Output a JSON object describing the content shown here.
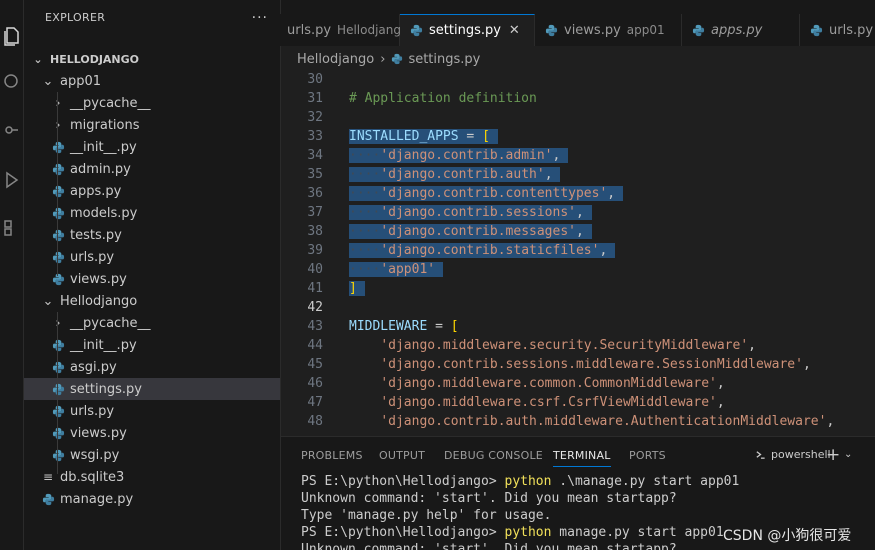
{
  "sidebar": {
    "title": "EXPLORER",
    "more": "···",
    "tree": [
      {
        "label": "HELLODJANGO",
        "kind": "root"
      },
      {
        "label": "app01",
        "kind": "folder-open"
      },
      {
        "label": "__pycache__",
        "kind": "folder"
      },
      {
        "label": "migrations",
        "kind": "folder"
      },
      {
        "label": "__init__.py",
        "kind": "py"
      },
      {
        "label": "admin.py",
        "kind": "py"
      },
      {
        "label": "apps.py",
        "kind": "py"
      },
      {
        "label": "models.py",
        "kind": "py"
      },
      {
        "label": "tests.py",
        "kind": "py"
      },
      {
        "label": "urls.py",
        "kind": "py"
      },
      {
        "label": "views.py",
        "kind": "py"
      },
      {
        "label": "Hellodjango",
        "kind": "folder-open"
      },
      {
        "label": "__pycache__",
        "kind": "folder"
      },
      {
        "label": "__init__.py",
        "kind": "py"
      },
      {
        "label": "asgi.py",
        "kind": "py"
      },
      {
        "label": "settings.py",
        "kind": "py",
        "selected": true
      },
      {
        "label": "urls.py",
        "kind": "py"
      },
      {
        "label": "views.py",
        "kind": "py"
      },
      {
        "label": "wsgi.py",
        "kind": "py"
      },
      {
        "label": "db.sqlite3",
        "kind": "db"
      },
      {
        "label": "manage.py",
        "kind": "py"
      }
    ]
  },
  "tabs": [
    {
      "label": "urls.py",
      "desc": "Hellodjango"
    },
    {
      "label": "settings.py",
      "desc": "",
      "active": true
    },
    {
      "label": "views.py",
      "desc": "app01"
    },
    {
      "label": "apps.py",
      "desc": "",
      "italic": true
    },
    {
      "label": "urls.py",
      "desc": ""
    }
  ],
  "breadcrumb": {
    "folder": "Hellodjango",
    "file": "settings.py"
  },
  "editor": {
    "current_line": "42",
    "lines": [
      {
        "n": "30",
        "text": ""
      },
      {
        "n": "31",
        "text": "# Application definition"
      },
      {
        "n": "32",
        "text": ""
      },
      {
        "n": "33",
        "text": "INSTALLED_APPS = ["
      },
      {
        "n": "34",
        "text": "'django.contrib.admin',"
      },
      {
        "n": "35",
        "text": "'django.contrib.auth',"
      },
      {
        "n": "36",
        "text": "'django.contrib.contenttypes',"
      },
      {
        "n": "37",
        "text": "'django.contrib.sessions',"
      },
      {
        "n": "38",
        "text": "'django.contrib.messages',"
      },
      {
        "n": "39",
        "text": "'django.contrib.staticfiles',"
      },
      {
        "n": "40",
        "text": "'app01'"
      },
      {
        "n": "41",
        "text": "]"
      },
      {
        "n": "42",
        "text": ""
      },
      {
        "n": "43",
        "text": "MIDDLEWARE = ["
      },
      {
        "n": "44",
        "text": "'django.middleware.security.SecurityMiddleware',"
      },
      {
        "n": "45",
        "text": "'django.contrib.sessions.middleware.SessionMiddleware',"
      },
      {
        "n": "46",
        "text": "'django.middleware.common.CommonMiddleware',"
      },
      {
        "n": "47",
        "text": "'django.middleware.csrf.CsrfViewMiddleware',"
      },
      {
        "n": "48",
        "text": "'django.contrib.auth.middleware.AuthenticationMiddleware',"
      }
    ]
  },
  "panel": {
    "tabs": [
      "PROBLEMS",
      "OUTPUT",
      "DEBUG CONSOLE",
      "TERMINAL",
      "PORTS"
    ],
    "active_tab": "TERMINAL",
    "shell": "powershell",
    "terminal": [
      {
        "prompt": "PS E:\\python\\Hellodjango> ",
        "cmd": "python",
        "rest": " .\\manage.py start app01"
      },
      {
        "prompt": "",
        "cmd": "",
        "rest": "Unknown command: 'start'. Did you mean startapp?"
      },
      {
        "prompt": "",
        "cmd": "",
        "rest": "Type 'manage.py help' for usage."
      },
      {
        "prompt": "PS E:\\python\\Hellodjango> ",
        "cmd": "python",
        "rest": " manage.py start app01"
      },
      {
        "prompt": "",
        "cmd": "",
        "rest": "Unknown command: 'start'. Did you mean startapp?"
      }
    ]
  },
  "watermark": "CSDN @小狗很可爱",
  "colors": {
    "accent": "#0078d4",
    "selection": "#264f78",
    "python_icon": "#519aba"
  }
}
